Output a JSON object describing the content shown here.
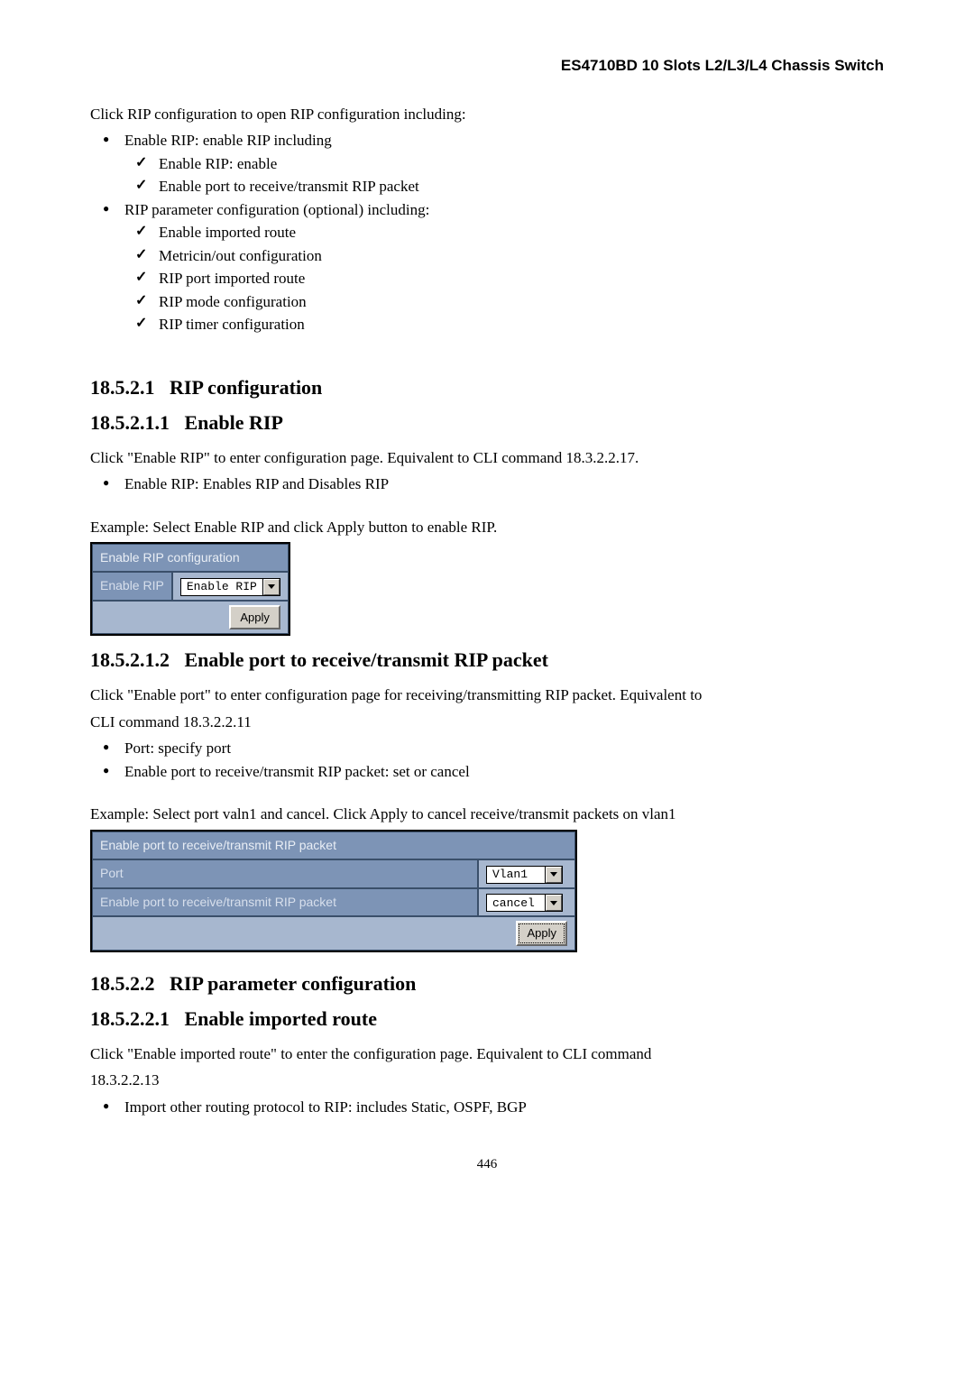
{
  "header": "ES4710BD 10 Slots L2/L3/L4 Chassis Switch",
  "intro": "Click RIP configuration to open RIP configuration including:",
  "list": {
    "a": "Enable RIP: enable RIP including",
    "a1": "Enable RIP: enable",
    "a2": "Enable port to receive/transmit RIP packet",
    "b": "RIP parameter configuration (optional) including:",
    "b1": "Enable imported route",
    "b2": "Metricin/out configuration",
    "b3": "RIP port imported route",
    "b4": "RIP mode configuration",
    "b5": "RIP timer configuration"
  },
  "s1": {
    "num": "18.5.2.1",
    "title": "RIP configuration",
    "sub_num": "18.5.2.1.1",
    "sub_title": "Enable RIP",
    "p1": "Click \"Enable RIP\"   to enter configuration page. Equivalent to CLI command 18.3.2.2.17.",
    "p2": "Enable RIP: Enables RIP and Disables RIP",
    "ex": "Example: Select Enable RIP and click Apply button to enable RIP.",
    "tbl": {
      "title": "Enable RIP configuration",
      "label": "Enable RIP",
      "value": "Enable RIP",
      "apply": "Apply"
    }
  },
  "s2": {
    "num": "18.5.2.1.2",
    "title": "Enable port to receive/transmit RIP packet",
    "p1": "Click \"Enable port\" to enter configuration page for receiving/transmitting RIP packet. Equivalent to",
    "p2": "CLI command 18.3.2.2.11",
    "l1": "Port: specify port",
    "l2": "Enable port to receive/transmit RIP packet: set or cancel",
    "ex": "Example: Select port valn1 and cancel. Click Apply to cancel receive/transmit packets on vlan1",
    "tbl": {
      "title": "Enable port to receive/transmit RIP packet",
      "row1_label": "Port",
      "row1_value": "Vlan1",
      "row2_label": "Enable port to receive/transmit RIP packet",
      "row2_value": "cancel",
      "apply": "Apply"
    }
  },
  "s3": {
    "num": "18.5.2.2",
    "title": "RIP parameter configuration",
    "sub_num": "18.5.2.2.1",
    "sub_title": "Enable imported route",
    "p1": "Click \"Enable imported route\" to enter the configuration page. Equivalent to CLI command",
    "p2": "18.3.2.2.13",
    "l1": "Import other routing protocol to RIP: includes Static, OSPF, BGP"
  },
  "page_number": "446"
}
